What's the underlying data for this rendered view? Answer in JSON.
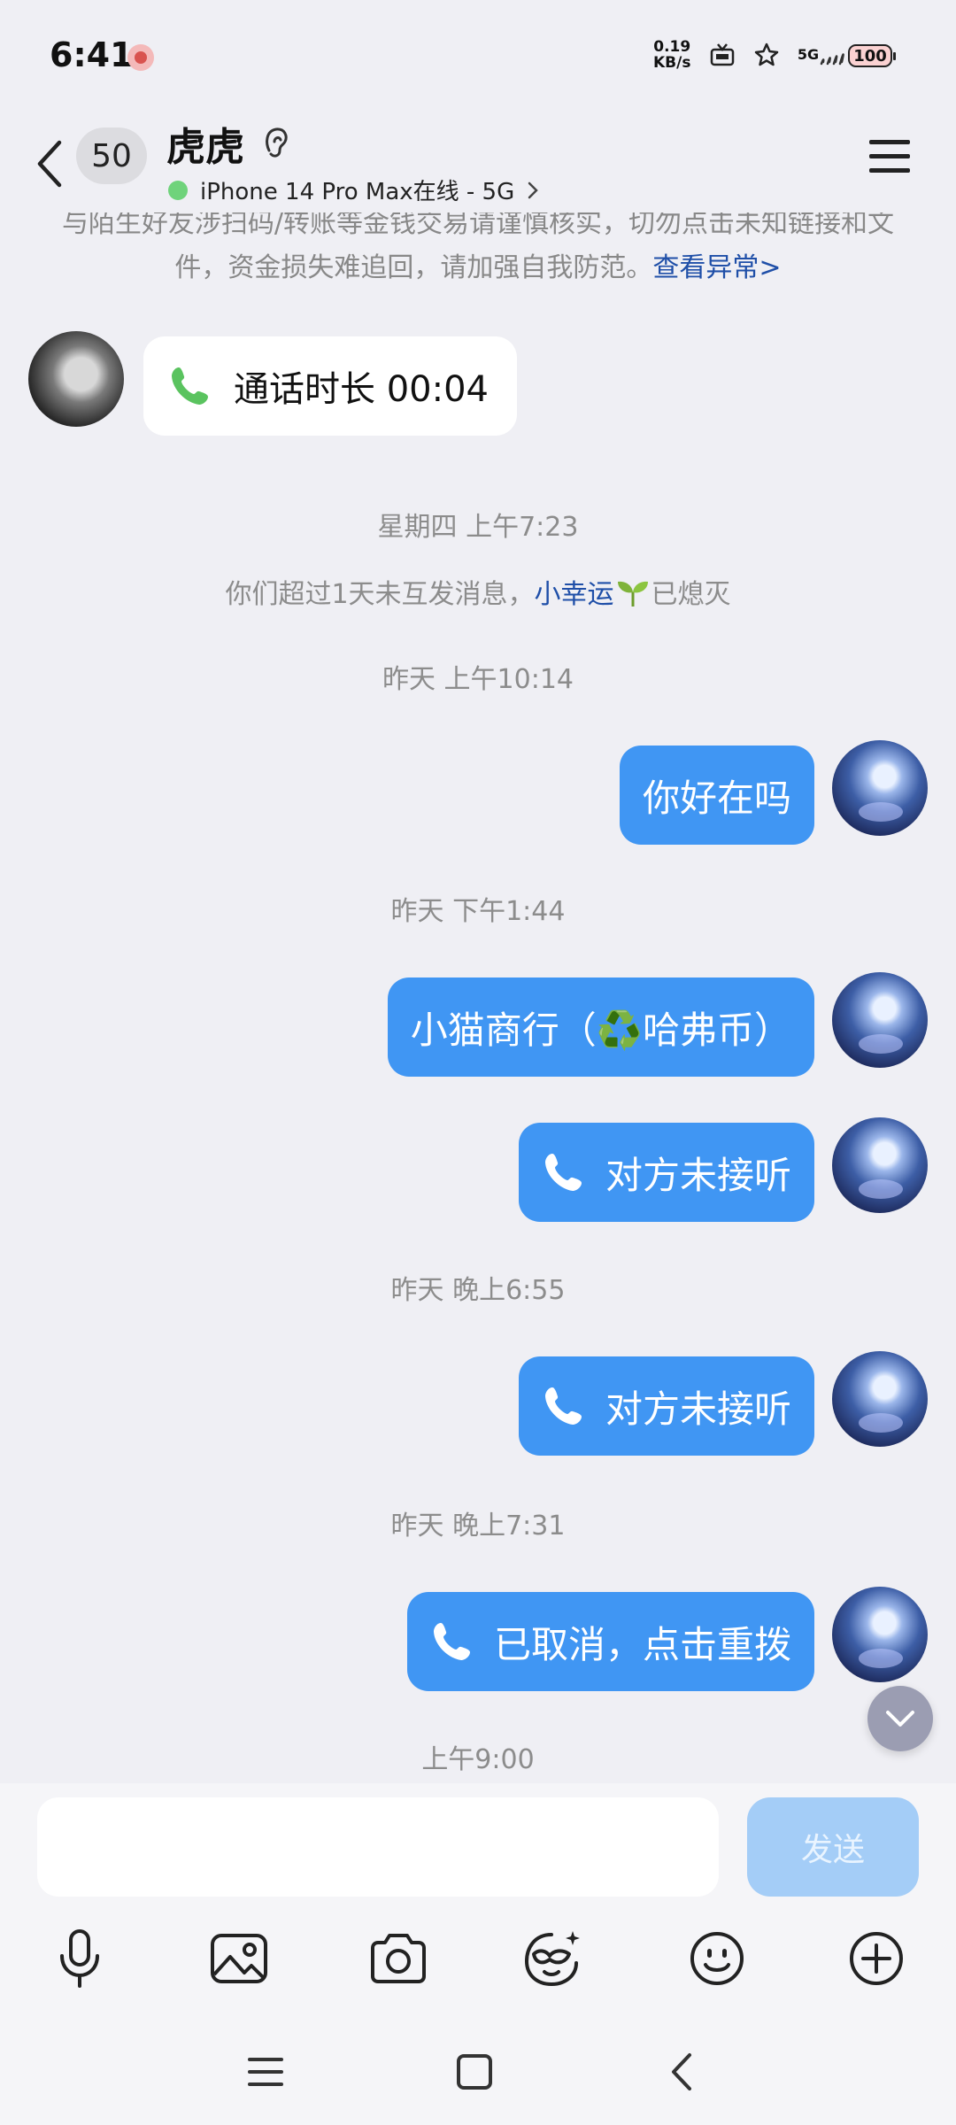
{
  "status_bar": {
    "time": "6:41",
    "net_speed_value": "0.19",
    "net_speed_unit": "KB/s",
    "signal_label": "5G",
    "battery": "100"
  },
  "header": {
    "unread_count": "50",
    "contact_name": "虎虎",
    "online_status": "iPhone 14 Pro Max在线 - 5G",
    "status_color": "#6fd37b"
  },
  "warning": {
    "text": "与陌生好友涉扫码/转账等金钱交易请谨慎核实，切勿点击未知链接和文件，资金损失难追回，请加强自我防范。",
    "link": "查看异常>"
  },
  "messages": {
    "call_duration": "通话时长 00:04",
    "ts1": "星期四 上午7:23",
    "sys_prefix": "你们超过1天未互发消息，",
    "sys_highlight": "小幸运",
    "sys_suffix": "已熄灭",
    "ts2": "昨天 上午10:14",
    "msg1": "你好在吗",
    "ts3": "昨天 下午1:44",
    "msg2": "小猫商行（♻️哈弗币）",
    "call_missed_1": "对方未接听",
    "ts4": "昨天 晚上6:55",
    "call_missed_2": "对方未接听",
    "ts5": "昨天 晚上7:31",
    "call_cancelled": "已取消，点击重拨",
    "ts6": "上午9:00"
  },
  "input": {
    "value": "",
    "send_label": "发送"
  },
  "toolbar_icons": [
    "microphone-icon",
    "image-icon",
    "camera-icon",
    "face-mask-icon",
    "emoji-icon",
    "plus-icon"
  ],
  "colors": {
    "outgoing_bubble": "#4096f3",
    "incoming_bubble": "#ffffff",
    "link": "#1f4fa8",
    "send_disabled": "#a4cdf7",
    "background": "#efeff4"
  }
}
